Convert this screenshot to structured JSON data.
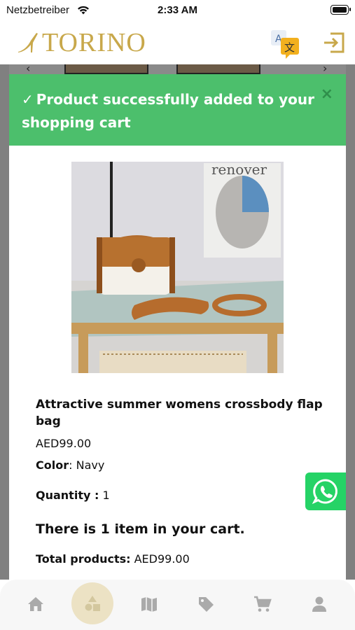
{
  "status_bar": {
    "carrier": "Netzbetreiber",
    "time": "2:33 AM"
  },
  "header": {
    "logo_text": "TORINO",
    "brand_color": "#c8a84b",
    "icons": [
      "translate-icon",
      "exit-icon"
    ]
  },
  "alert": {
    "message": "Product successfully added to your shopping cart",
    "check": "✓",
    "close": "×",
    "color": "#4cbf6c"
  },
  "product": {
    "title": "Attractive summer womens crossbody flap bag",
    "price": "AED99.00",
    "color_label": "Color",
    "color_value": "Navy",
    "quantity_label": "Quantity :",
    "quantity_value": "1",
    "image_caption": "renover"
  },
  "cart": {
    "summary": "There is 1 item in your cart.",
    "total_label": "Total products:",
    "total_value": "AED99.00"
  },
  "bottom_nav": {
    "items": [
      "home-icon",
      "categories-icon",
      "map-icon",
      "tag-icon",
      "cart-icon",
      "user-icon"
    ],
    "active": "categories-icon"
  }
}
